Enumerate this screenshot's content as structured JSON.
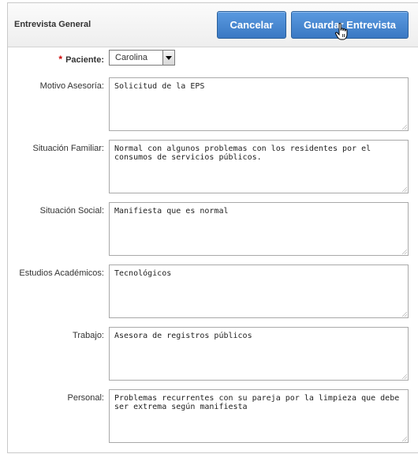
{
  "header": {
    "title": "Entrevista General",
    "cancel_label": "Cancelar",
    "save_label": "Guardar Entrevista"
  },
  "form": {
    "paciente": {
      "label": "Paciente:",
      "required_mark": "*",
      "value": "Carolina"
    },
    "fields": [
      {
        "label": "Motivo Asesoría:",
        "value": "Solicitud de la EPS"
      },
      {
        "label": "Situación Familiar:",
        "value": "Normal con algunos problemas con los residentes por el consumos de servicios públicos."
      },
      {
        "label": "Situación Social:",
        "value": "Manifiesta que es normal"
      },
      {
        "label": "Estudios Académicos:",
        "value": "Tecnológicos"
      },
      {
        "label": "Trabajo:",
        "value": "Asesora de registros públicos"
      },
      {
        "label": "Personal:",
        "value": "Problemas recurrentes con su pareja por la limpieza que debe ser extrema según manifiesta"
      }
    ]
  },
  "colors": {
    "button": "#3a78c3",
    "required": "#cc0000"
  },
  "icons": {
    "cursor": "hand-pointer-icon",
    "select_arrow": "chevron-down-icon",
    "resize": "resize-grip-icon"
  }
}
